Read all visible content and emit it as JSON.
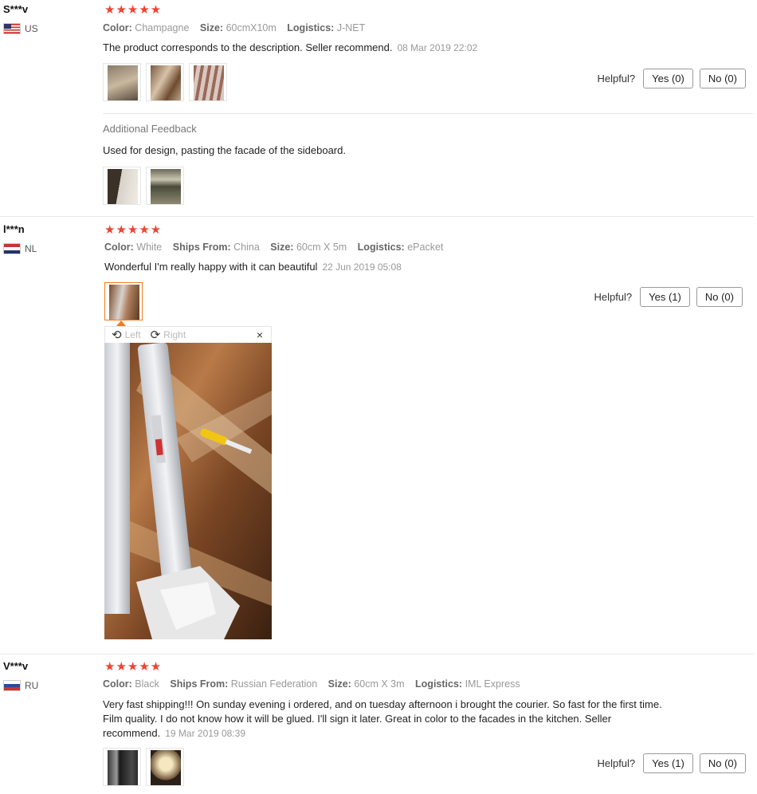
{
  "reviews": [
    {
      "user": "S***v",
      "country": "US",
      "stars": "★★★★★",
      "attrs": [
        {
          "k": "Color:",
          "v": "Champagne"
        },
        {
          "k": "Size:",
          "v": "60cmX10m"
        },
        {
          "k": "Logistics:",
          "v": "J-NET"
        }
      ],
      "text": "The product corresponds to the description. Seller recommend.",
      "date": "08 Mar 2019 22:02",
      "yes": "Yes (0)",
      "no": "No (0)",
      "additional_title": "Additional Feedback",
      "additional_text": "Used for design, pasting the facade of the sideboard."
    },
    {
      "user": "l***n",
      "country": "NL",
      "stars": "★★★★★",
      "attrs": [
        {
          "k": "Color:",
          "v": "White"
        },
        {
          "k": "Ships From:",
          "v": "China"
        },
        {
          "k": "Size:",
          "v": "60cm X 5m"
        },
        {
          "k": "Logistics:",
          "v": "ePacket"
        }
      ],
      "text": "Wonderful I'm really happy with it can beautiful",
      "date": "22 Jun 2019 05:08",
      "yes": "Yes (1)",
      "no": "No (0)",
      "viewer": {
        "left": "Left",
        "right": "Right",
        "close": "×"
      }
    },
    {
      "user": "V***v",
      "country": "RU",
      "stars": "★★★★★",
      "attrs": [
        {
          "k": "Color:",
          "v": "Black"
        },
        {
          "k": "Ships From:",
          "v": "Russian Federation"
        },
        {
          "k": "Size:",
          "v": "60cm X 3m"
        },
        {
          "k": "Logistics:",
          "v": "IML Express"
        }
      ],
      "text": "Very fast shipping!!! On sunday evening i ordered, and on tuesday afternoon i brought the courier. So fast for the first time. Film quality. I do not know how it will be glued. I'll sign it later. Great in color to the facades in the kitchen. Seller recommend.",
      "date": "19 Mar 2019 08:39",
      "yes": "Yes (1)",
      "no": "No (0)"
    }
  ],
  "helpful_label": "Helpful?"
}
